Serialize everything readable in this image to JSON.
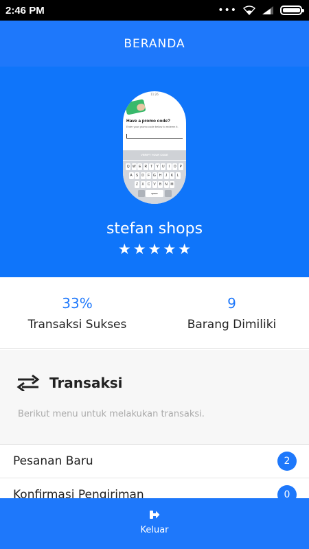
{
  "status_bar": {
    "time": "2:46 PM",
    "icons": [
      "more-dots-icon",
      "wifi-icon",
      "signal-icon",
      "battery-icon"
    ]
  },
  "app_bar": {
    "title": "BERANDA"
  },
  "shop": {
    "avatar_text": {
      "time": "11:26",
      "title": "Have a promo code?",
      "subtitle": "Enter your promo code below to redeem it.",
      "button": "VERIFY YOUR CODE",
      "keyboard_rows": [
        [
          "Q",
          "W",
          "E",
          "R",
          "T",
          "Y",
          "U",
          "I",
          "O",
          "P"
        ],
        [
          "A",
          "S",
          "D",
          "F",
          "G",
          "H",
          "J",
          "K",
          "L"
        ],
        [
          "Z",
          "X",
          "C",
          "V",
          "B",
          "N",
          "M"
        ]
      ],
      "space_key": "space"
    },
    "name": "stefan shops",
    "rating": 5,
    "stars": [
      "★",
      "★",
      "★",
      "★",
      "★"
    ]
  },
  "stats": [
    {
      "value": "33%",
      "label": "Transaksi Sukses"
    },
    {
      "value": "9",
      "label": "Barang Dimiliki"
    }
  ],
  "menu": {
    "icon": "swap-arrows-icon",
    "title": "Transaksi",
    "description": "Berikut menu untuk melakukan transaksi.",
    "items": [
      {
        "label": "Pesanan Baru",
        "badge": "2"
      },
      {
        "label": "Konfirmasi Pengiriman",
        "badge": "0"
      }
    ]
  },
  "bottom_bar": {
    "icon": "logout-icon",
    "label": "Keluar"
  },
  "colors": {
    "primary": "#1e78fb",
    "hero": "#0f75fa",
    "status_bar": "#000000",
    "menu_bg": "#f7f7f7"
  }
}
